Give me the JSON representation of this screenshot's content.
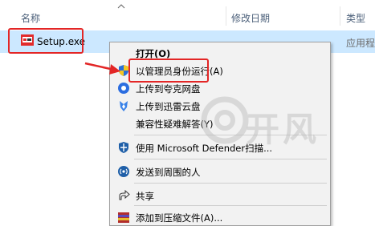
{
  "explorer": {
    "columns": {
      "name": "名称",
      "modified": "修改日期",
      "type": "类型"
    },
    "file": {
      "name": "Setup.exe",
      "type": "应用程"
    }
  },
  "context_menu": {
    "items": [
      {
        "label": "打开(O)",
        "icon": ""
      },
      {
        "label": "以管理员身份运行(A)",
        "icon": "uac-shield-icon"
      },
      {
        "label": "上传到夸克网盘",
        "icon": "quark-icon"
      },
      {
        "label": "上传到迅雷云盘",
        "icon": "xunlei-icon"
      },
      {
        "label": "兼容性疑难解答(Y)",
        "icon": ""
      },
      {
        "label": "使用 Microsoft Defender扫描...",
        "icon": "defender-icon"
      },
      {
        "label": "发送到周围的人",
        "icon": "nearby-share-icon"
      },
      {
        "label": "共享",
        "icon": "share-icon"
      },
      {
        "label": "添加到压缩文件(A)...",
        "icon": "archive-icon"
      }
    ]
  },
  "watermark": {
    "text": "@开风"
  },
  "colors": {
    "highlight_border": "#e32626",
    "selection": "#cce8ff"
  }
}
